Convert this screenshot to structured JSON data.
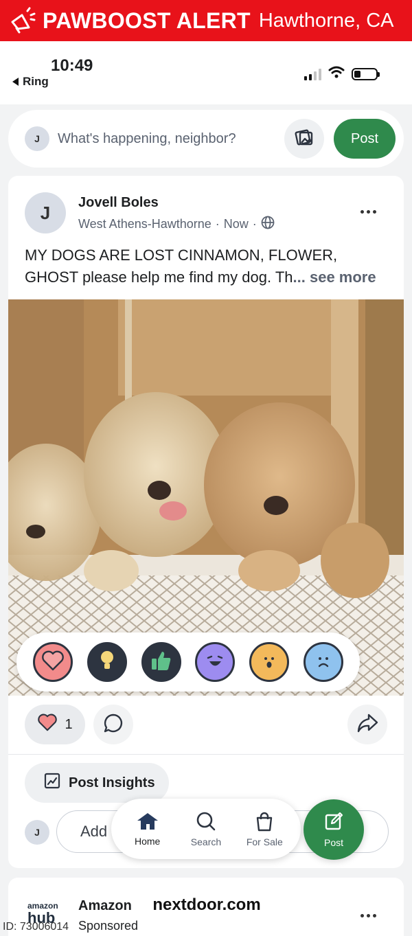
{
  "alert": {
    "title": "PAWBOOST ALERT",
    "location": "Hawthorne, CA"
  },
  "status_bar": {
    "time": "10:49",
    "back_app": "Ring"
  },
  "composer": {
    "avatar_initial": "J",
    "prompt": "What's happening, neighbor?",
    "post_label": "Post"
  },
  "post": {
    "author_initial": "J",
    "author_name": "Jovell Boles",
    "neighborhood": "West Athens-Hawthorne",
    "separator": "·",
    "timestamp": "Now",
    "text_line1": "MY DOGS ARE LOST CINNAMON, FLOWER,",
    "text_line2": "GHOST please help me find my dog. Th",
    "ellipsis": "...",
    "see_more": "see more",
    "like_count": "1",
    "insights_label": "Post Insights",
    "reply_avatar_initial": "J",
    "reply_placeholder": "Add"
  },
  "reactions": [
    {
      "name": "heart",
      "color": "#f28b8b"
    },
    {
      "name": "lightbulb",
      "color": "#f5d77a"
    },
    {
      "name": "thumbs-up",
      "color": "#5fc08a"
    },
    {
      "name": "laughing",
      "color": "#9d8cf0"
    },
    {
      "name": "surprised",
      "color": "#f3b95b"
    },
    {
      "name": "sad",
      "color": "#8fc2ee"
    }
  ],
  "bottom_nav": [
    {
      "label": "Home",
      "icon": "home-icon",
      "active": true
    },
    {
      "label": "Search",
      "icon": "search-icon",
      "active": false
    },
    {
      "label": "For Sale",
      "icon": "shopping-bag-icon",
      "active": false
    }
  ],
  "fab": {
    "label": "Post"
  },
  "sponsored": {
    "logo_top": "amazon",
    "logo_bottom": "hub",
    "name": "Amazon",
    "label": "Sponsored"
  },
  "source": "nextdoor.com",
  "image_id": "ID: 73006014",
  "colors": {
    "alert_red": "#e8121a",
    "brand_green": "#2f8a4c"
  }
}
